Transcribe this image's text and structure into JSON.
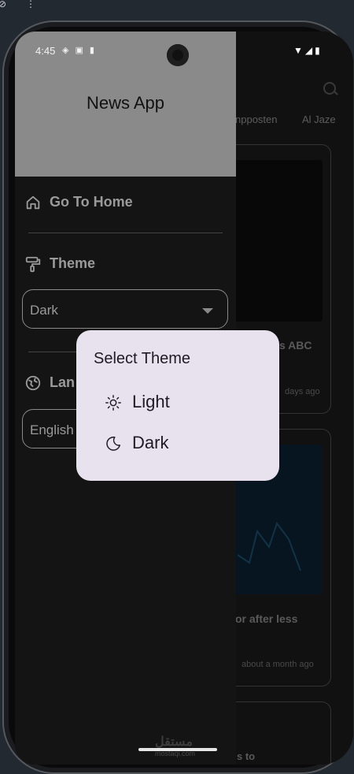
{
  "header": {
    "app_title": "News App"
  },
  "status": {
    "time": "4:45"
  },
  "background": {
    "tabs": [
      "npposten",
      "Al Jaze"
    ],
    "cards": [
      {
        "title": "s ABC",
        "time": "days ago"
      },
      {
        "title": "or after less",
        "time": "about a month ago"
      }
    ],
    "partial_text": "s to"
  },
  "drawer": {
    "home_label": "Go To Home",
    "theme_label": "Theme",
    "theme_value": "Dark",
    "language_label": "Lan",
    "language_value": "English"
  },
  "dialog": {
    "title": "Select Theme",
    "options": [
      {
        "label": "Light",
        "icon": "sun-icon"
      },
      {
        "label": "Dark",
        "icon": "moon-icon"
      }
    ]
  },
  "watermark": {
    "text": "مستقل",
    "domain": "mostaqi.com"
  }
}
